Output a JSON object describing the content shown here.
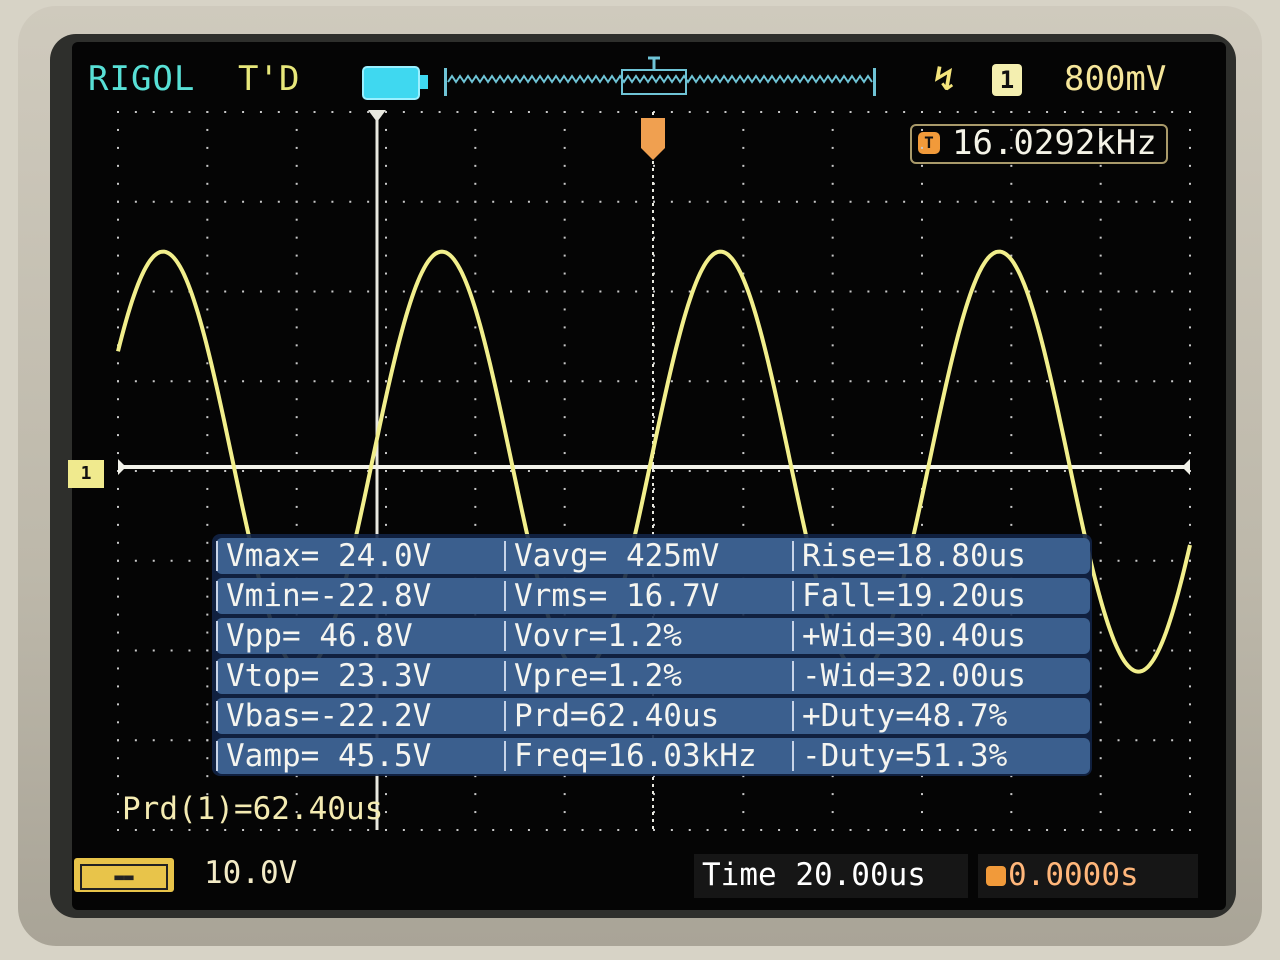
{
  "header": {
    "brand": "RIGOL",
    "trigger_status": "T'D",
    "trigger_level": "800mV",
    "trigger_channel": "1",
    "trigger_slope_icon": "rising-edge-icon"
  },
  "frequency_counter": {
    "icon": "T",
    "value": "16.0292kHz"
  },
  "channel_marker": "1",
  "measurements": [
    [
      "Vmax= 24.0V",
      "Vavg= 425mV",
      "Rise=18.80us"
    ],
    [
      "Vmin=-22.8V",
      "Vrms= 16.7V",
      "Fall=19.20us"
    ],
    [
      "Vpp= 46.8V",
      "Vovr=1.2%",
      "+Wid=30.40us"
    ],
    [
      "Vtop= 23.3V",
      "Vpre=1.2%",
      "-Wid=32.00us"
    ],
    [
      "Vbas=-22.2V",
      "Prd=62.40us",
      "+Duty=48.7%"
    ],
    [
      "Vamp= 45.5V",
      "Freq=16.03kHz",
      "-Duty=51.3%"
    ]
  ],
  "period_readout": "Prd(1)=62.40us",
  "footer": {
    "channel_icon": "channel-1-icon",
    "vertical_scale": "10.0V",
    "timebase": "Time 20.00us",
    "trigger_offset": "0.0000s"
  },
  "colors": {
    "trace": "#f2ef8c",
    "grid": "#c9c9c9",
    "panel": "#3b5f8e",
    "brand": "#58e0d6"
  }
}
